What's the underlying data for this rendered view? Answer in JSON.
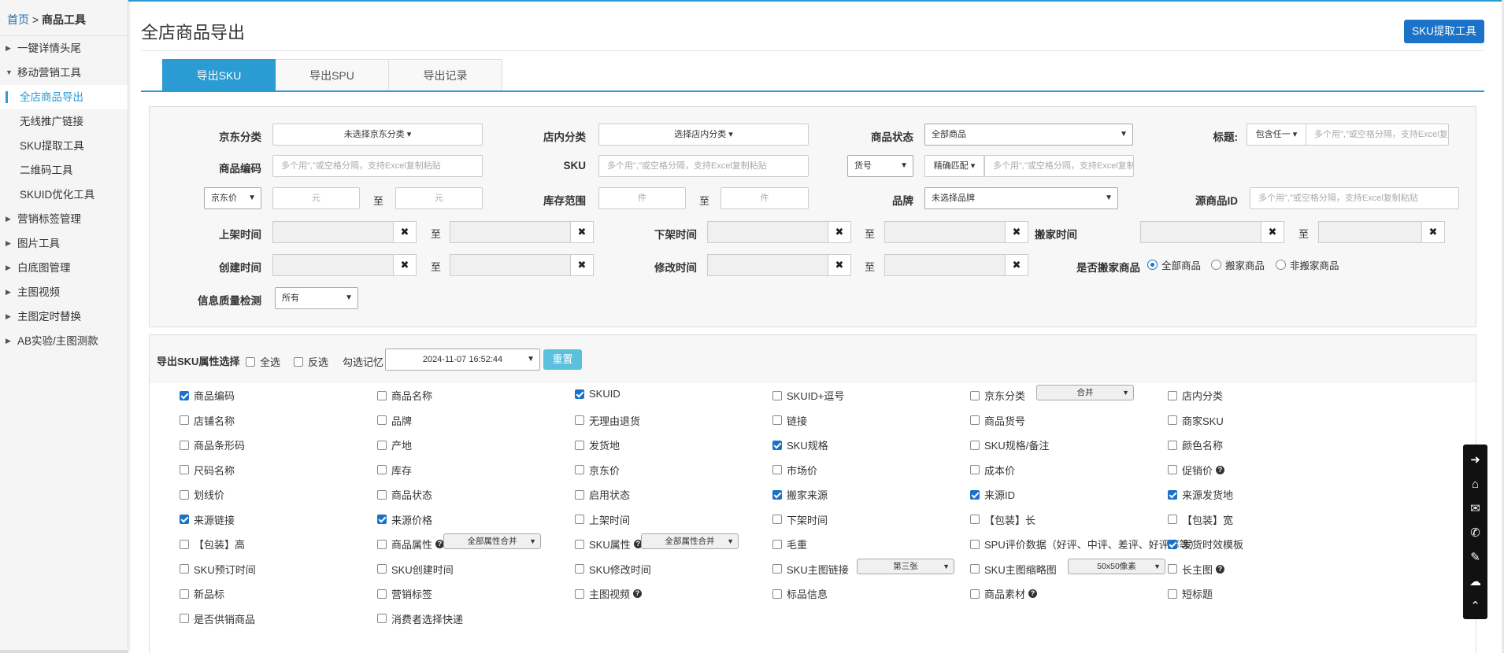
{
  "breadcrumb": {
    "home": "首页",
    "sep": " > ",
    "current": "商品工具"
  },
  "sidebar": {
    "items": [
      {
        "label": "一键详情头尾",
        "type": "group",
        "expanded": false
      },
      {
        "label": "移动营销工具",
        "type": "group",
        "expanded": true
      },
      {
        "label": "全店商品导出",
        "type": "sub",
        "active": true
      },
      {
        "label": "无线推广链接",
        "type": "sub"
      },
      {
        "label": "SKU提取工具",
        "type": "sub"
      },
      {
        "label": "二维码工具",
        "type": "sub"
      },
      {
        "label": "SKUID优化工具",
        "type": "sub"
      },
      {
        "label": "营销标签管理",
        "type": "group",
        "expanded": false
      },
      {
        "label": "图片工具",
        "type": "group",
        "expanded": false
      },
      {
        "label": "白底图管理",
        "type": "group",
        "expanded": false
      },
      {
        "label": "主图视频",
        "type": "group",
        "expanded": false
      },
      {
        "label": "主图定时替换",
        "type": "group",
        "expanded": false
      },
      {
        "label": "AB实验/主图测款",
        "type": "group",
        "expanded": false
      }
    ]
  },
  "page": {
    "title": "全店商品导出",
    "sku_tool_button": "SKU提取工具"
  },
  "tabs": [
    {
      "label": "导出SKU",
      "active": true
    },
    {
      "label": "导出SPU"
    },
    {
      "label": "导出记录"
    }
  ],
  "filters": {
    "jd_category": {
      "label": "京东分类",
      "value": "未选择京东分类"
    },
    "shop_category": {
      "label": "店内分类",
      "value": "选择店内分类"
    },
    "product_status": {
      "label": "商品状态",
      "value": "全部商品"
    },
    "title": {
      "label": "标题:",
      "mode": "包含任一",
      "placeholder": "多个用\",\"或空格分隔，支持Excel复制粘贴"
    },
    "product_code": {
      "label": "商品编码",
      "placeholder": "多个用\",\"或空格分隔，支持Excel复制粘贴"
    },
    "sku": {
      "label": "SKU",
      "placeholder": "多个用\",\"或空格分隔，支持Excel复制粘贴"
    },
    "item_no": {
      "select": "货号",
      "match": "精确匹配",
      "placeholder": "多个用\",\"或空格分隔，支持Excel复制粘贴"
    },
    "price": {
      "select": "京东价",
      "unit": "元",
      "to": "至"
    },
    "stock_range": {
      "label": "库存范围",
      "unit": "件",
      "to": "至"
    },
    "brand": {
      "label": "品牌",
      "value": "未选择品牌"
    },
    "source_id": {
      "label": "源商品ID",
      "placeholder": "多个用\",\"或空格分隔，支持Excel复制粘贴"
    },
    "listed_time": {
      "label": "上架时间",
      "to": "至"
    },
    "delisted_time": {
      "label": "下架时间",
      "to": "至"
    },
    "move_time": {
      "label": "搬家时间",
      "to": "至"
    },
    "created_time": {
      "label": "创建时间",
      "to": "至"
    },
    "modified_time": {
      "label": "修改时间",
      "to": "至"
    },
    "moved_goods": {
      "label": "是否搬家商品",
      "options": [
        "全部商品",
        "搬家商品",
        "非搬家商品"
      ],
      "selected": 0
    },
    "info_quality": {
      "label": "信息质量检测",
      "value": "所有"
    }
  },
  "attributes": {
    "title": "导出SKU属性选择",
    "select_all": "全选",
    "invert": "反选",
    "memory_label": "勾选记忆",
    "memory_value": "2024-11-07 16:52:44",
    "reset": "重置",
    "items": [
      {
        "label": "商品编码",
        "checked": true
      },
      {
        "label": "商品名称",
        "checked": false
      },
      {
        "label": "SKUID",
        "checked": true
      },
      {
        "label": "SKUID+逗号",
        "checked": false
      },
      {
        "label": "京东分类",
        "checked": false,
        "select": "合并"
      },
      {
        "label": "店内分类",
        "checked": false
      },
      {
        "label": "店铺名称",
        "checked": false
      },
      {
        "label": "品牌",
        "checked": false
      },
      {
        "label": "无理由退货",
        "checked": false
      },
      {
        "label": "链接",
        "checked": false
      },
      {
        "label": "商品货号",
        "checked": false
      },
      {
        "label": "商家SKU",
        "checked": false
      },
      {
        "label": "商品条形码",
        "checked": false
      },
      {
        "label": "产地",
        "checked": false
      },
      {
        "label": "发货地",
        "checked": false
      },
      {
        "label": "SKU规格",
        "checked": true
      },
      {
        "label": "SKU规格/备注",
        "checked": false
      },
      {
        "label": "颜色名称",
        "checked": false
      },
      {
        "label": "尺码名称",
        "checked": false
      },
      {
        "label": "库存",
        "checked": false
      },
      {
        "label": "京东价",
        "checked": false
      },
      {
        "label": "市场价",
        "checked": false
      },
      {
        "label": "成本价",
        "checked": false
      },
      {
        "label": "促销价",
        "checked": false,
        "help": true
      },
      {
        "label": "划线价",
        "checked": false
      },
      {
        "label": "商品状态",
        "checked": false
      },
      {
        "label": "启用状态",
        "checked": false
      },
      {
        "label": "搬家来源",
        "checked": true
      },
      {
        "label": "来源ID",
        "checked": true
      },
      {
        "label": "来源发货地",
        "checked": true
      },
      {
        "label": "来源链接",
        "checked": true
      },
      {
        "label": "来源价格",
        "checked": true
      },
      {
        "label": "上架时间",
        "checked": false
      },
      {
        "label": "下架时间",
        "checked": false
      },
      {
        "label": "【包装】长",
        "checked": false
      },
      {
        "label": "【包装】宽",
        "checked": false
      },
      {
        "label": "【包装】高",
        "checked": false
      },
      {
        "label": "商品属性",
        "checked": false,
        "help": true,
        "select": "全部属性合并"
      },
      {
        "label": "SKU属性",
        "checked": false,
        "help": true,
        "select": "全部属性合并"
      },
      {
        "label": "毛重",
        "checked": false
      },
      {
        "label": "SPU评价数据（好评、中评、差评、好评率等）",
        "checked": false
      },
      {
        "label": "发货时效模板",
        "checked": true
      },
      {
        "label": "SKU预订时间",
        "checked": false
      },
      {
        "label": "SKU创建时间",
        "checked": false
      },
      {
        "label": "SKU修改时间",
        "checked": false
      },
      {
        "label": "SKU主图链接",
        "checked": false,
        "select": "第三张"
      },
      {
        "label": "SKU主图缩略图",
        "checked": false,
        "select": "50x50像素"
      },
      {
        "label": "长主图",
        "checked": false,
        "help": true
      },
      {
        "label": "新品标",
        "checked": false
      },
      {
        "label": "营销标签",
        "checked": false
      },
      {
        "label": "主图视频",
        "checked": false,
        "help": true
      },
      {
        "label": "标品信息",
        "checked": false
      },
      {
        "label": "商品素材",
        "checked": false,
        "help": true
      },
      {
        "label": "短标题",
        "checked": false
      },
      {
        "label": "是否供销商品",
        "checked": false
      },
      {
        "label": "消费者选择快递",
        "checked": false
      }
    ]
  },
  "float_toolbar": [
    "arrow-right-icon",
    "home-icon",
    "mail-icon",
    "chat-icon",
    "edit-icon",
    "wechat-icon",
    "arrow-up-icon"
  ],
  "colors": {
    "accent": "#2b9bd3",
    "primary_button": "#1a73c8",
    "reset_button": "#5bc0de"
  }
}
